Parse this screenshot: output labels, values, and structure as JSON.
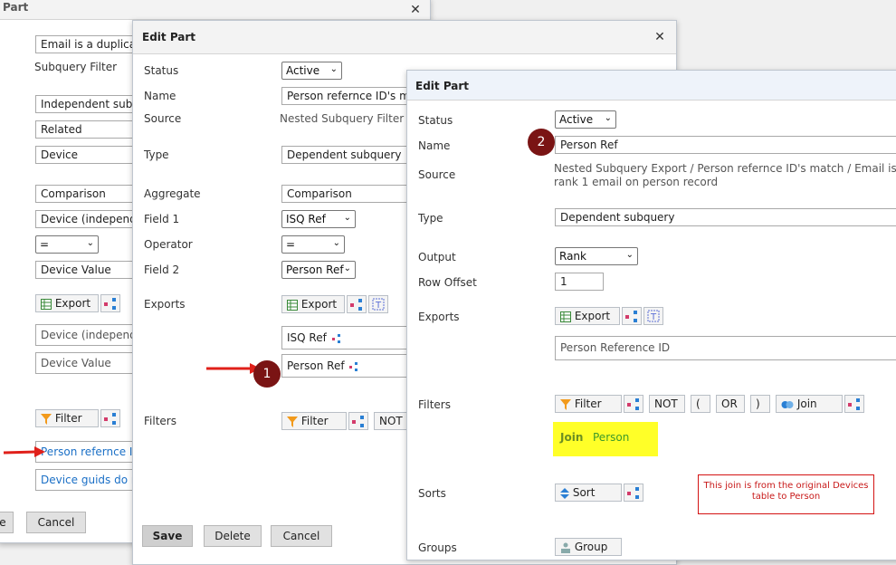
{
  "back": {
    "title": "Part",
    "email_field": "Email is a duplicate",
    "subquery_filter_label": "Subquery Filter",
    "independent_subquery": "Independent subqu",
    "related": "Related",
    "device": "Device",
    "comparison": "Comparison",
    "device_independent": "Device (independer",
    "operator": "=",
    "device_value": "Device Value",
    "export_label": "Export",
    "export_row1": "Device (independer",
    "export_row2": "Device Value",
    "filter_label": "Filter",
    "filter_row1": "Person refernce ID's",
    "filter_row2": "Device guids do not",
    "save_label": "e",
    "cancel_label": "Cancel"
  },
  "middle": {
    "title": "Edit Part",
    "status_label": "Status",
    "status_value": "Active",
    "name_label": "Name",
    "name_value": "Person refernce ID's match",
    "source_label": "Source",
    "source_value": "Nested Subquery Filter / E",
    "type_label": "Type",
    "type_value": "Dependent subquery",
    "aggregate_label": "Aggregate",
    "aggregate_value": "Comparison",
    "field1_label": "Field 1",
    "field1_value": "ISQ Ref",
    "operator_label": "Operator",
    "operator_value": "=",
    "field2_label": "Field 2",
    "field2_value": "Person Ref",
    "exports_label": "Exports",
    "export_btn": "Export",
    "export_row1": "ISQ Ref",
    "export_row2": "Person Ref",
    "filters_label": "Filters",
    "filter_btn": "Filter",
    "not_btn": "NOT",
    "save_btn": "Save",
    "delete_btn": "Delete",
    "cancel_btn": "Cancel"
  },
  "front": {
    "title": "Edit Part",
    "status_label": "Status",
    "status_value": "Active",
    "name_label": "Name",
    "name_value": "Person Ref",
    "source_label": "Source",
    "source_line1": "Nested Subquery Export / Person refernce ID's match / Email is a duplic",
    "source_line2": "rank 1 email on person record",
    "type_label": "Type",
    "type_value": "Dependent subquery",
    "output_label": "Output",
    "output_value": "Rank",
    "row_offset_label": "Row Offset",
    "row_offset_value": "1",
    "exports_label": "Exports",
    "export_btn": "Export",
    "export_row1": "Person Reference ID",
    "filters_label": "Filters",
    "filter_btn": "Filter",
    "not_btn": "NOT",
    "open_paren": "(",
    "or_btn": "OR",
    "close_paren": ")",
    "join_btn": "Join",
    "join_keyword": "Join",
    "join_target": "Person",
    "note": "This join is from the original Devices table to Person",
    "sorts_label": "Sorts",
    "sort_btn": "Sort",
    "groups_label": "Groups",
    "group_btn": "Group"
  },
  "badges": {
    "one": "1",
    "two": "2"
  },
  "colors": {
    "badge": "#7a1414",
    "highlight": "#ffff28",
    "link": "#1a6fc6",
    "arrow": "#e0201a",
    "note_border": "#d41313"
  }
}
